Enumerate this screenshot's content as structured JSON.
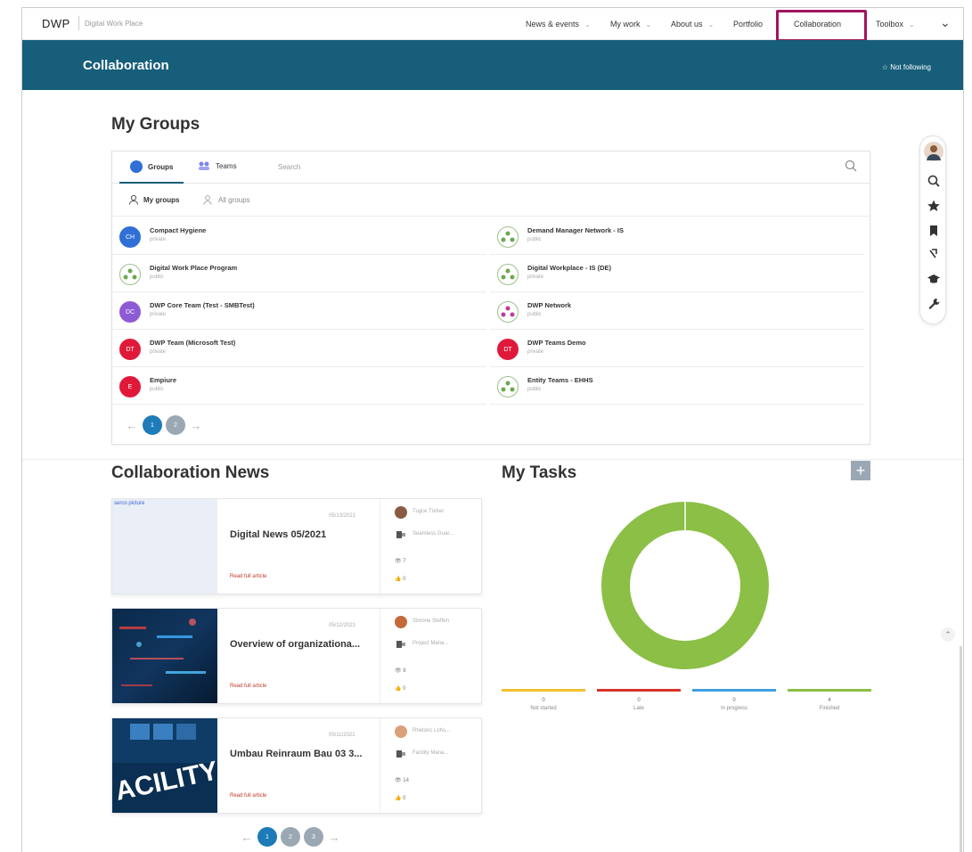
{
  "header": {
    "logo": "DWP",
    "logo_subtitle": "Digital Work Place",
    "nav": [
      {
        "label": "News & events",
        "has_menu": true
      },
      {
        "label": "My work",
        "has_menu": true
      },
      {
        "label": "About us",
        "has_menu": true
      },
      {
        "label": "Portfolio",
        "has_menu": false
      },
      {
        "label": "Collaboration",
        "has_menu": false
      },
      {
        "label": "Toolbox",
        "has_menu": true
      }
    ]
  },
  "banner": {
    "title": "Collaboration",
    "follow_label": "Not following"
  },
  "my_groups": {
    "heading": "My Groups",
    "tabs": [
      {
        "label": "Groups",
        "icon": "groups-icon"
      },
      {
        "label": "Teams",
        "icon": "teams-icon"
      }
    ],
    "search_placeholder": "Search",
    "subtabs": [
      {
        "label": "My groups"
      },
      {
        "label": "All groups"
      }
    ],
    "groups": [
      {
        "name": "Compact Hygiene",
        "visibility": "private",
        "initials": "CH",
        "color": "#2f6fd6",
        "type": "initials"
      },
      {
        "name": "Demand Manager Network - IS",
        "visibility": "public",
        "initials": "",
        "color": "#6aa84f",
        "type": "network"
      },
      {
        "name": "Digital Work Place Program",
        "visibility": "public",
        "initials": "",
        "color": "#6aa84f",
        "type": "network"
      },
      {
        "name": "Digital Workplace - IS (DE)",
        "visibility": "private",
        "initials": "",
        "color": "#6aa84f",
        "type": "network"
      },
      {
        "name": "DWP Core Team (Test - SMBTest)",
        "visibility": "private",
        "initials": "DC",
        "color": "#8e5bd6",
        "type": "initials"
      },
      {
        "name": "DWP Network",
        "visibility": "public",
        "initials": "",
        "color": "#c0399a",
        "type": "network"
      },
      {
        "name": "DWP Team (Microsoft Test)",
        "visibility": "private",
        "initials": "DT",
        "color": "#e0193a",
        "type": "initials"
      },
      {
        "name": "DWP Teams Demo",
        "visibility": "private",
        "initials": "DT",
        "color": "#e0193a",
        "type": "initials"
      },
      {
        "name": "Empiure",
        "visibility": "public",
        "initials": "E",
        "color": "#e0193a",
        "type": "initials"
      },
      {
        "name": "Entity Teams - EHHS",
        "visibility": "public",
        "initials": "",
        "color": "#6aa84f",
        "type": "network"
      }
    ],
    "pagination": {
      "pages": [
        "1",
        "2"
      ],
      "current": 1
    }
  },
  "news": {
    "heading": "Collaboration News",
    "image_alt": "serco picture",
    "read_more": "Read full article",
    "items": [
      {
        "date": "05/13/2021",
        "title": "Digital News 05/2021",
        "author": "Tugce Türker",
        "role": "Seamless Guar...",
        "views": "7",
        "likes": "0",
        "image": "placeholder"
      },
      {
        "date": "05/12/2021",
        "title": "Overview of organizationa...",
        "author": "Simone Steffen",
        "role": "Project Mana...",
        "views": "8",
        "likes": "0",
        "image": "tech"
      },
      {
        "date": "05/11/2021",
        "title": "Umbau Reinraum Bau 03 3...",
        "author": "Rhetoric Lohs...",
        "role": "Facility Mana...",
        "views": "14",
        "likes": "0",
        "image": "facility"
      }
    ],
    "pagination": {
      "pages": [
        "1",
        "2",
        "3"
      ],
      "current": 1
    }
  },
  "tasks": {
    "heading": "My Tasks",
    "chart_data": {
      "type": "pie",
      "title": "",
      "categories": [
        "Not started",
        "Late",
        "In progress",
        "Finished"
      ],
      "values": [
        0,
        0,
        0,
        4
      ],
      "colors": [
        "#f2c12e",
        "#d9342b",
        "#3fa0e0",
        "#8bbf45"
      ]
    },
    "legend": [
      {
        "label": "Not started",
        "value": "0",
        "color": "#f2c12e"
      },
      {
        "label": "Late",
        "value": "0",
        "color": "#d9342b"
      },
      {
        "label": "In progress",
        "value": "0",
        "color": "#3fa0e0"
      },
      {
        "label": "Finished",
        "value": "4",
        "color": "#8bbf45"
      }
    ]
  },
  "side_tools": [
    "user-avatar",
    "search-icon",
    "star-icon",
    "bookmark-icon",
    "share-icon",
    "graduation-icon",
    "wrench-icon"
  ]
}
